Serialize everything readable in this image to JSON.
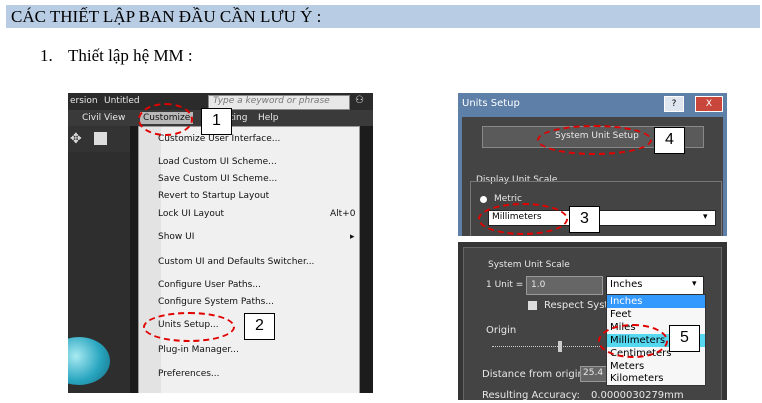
{
  "heading": "CÁC THIẾT LẬP BAN ĐẦU CẦN LƯU Ý :",
  "step": {
    "number": "1.",
    "text": "Thiết lập hệ MM :"
  },
  "max_window": {
    "title_left": "ersion",
    "title_doc": "Untitled",
    "search_placeholder": "Type a keyword or phrase",
    "menubar": [
      "Civil View",
      "Customize",
      "ting",
      "Help"
    ],
    "menu_items": [
      {
        "label": "Customize User Interface...",
        "shortcut": ""
      },
      {
        "label": "Load Custom UI Scheme...",
        "shortcut": ""
      },
      {
        "label": "Save Custom UI Scheme...",
        "shortcut": ""
      },
      {
        "label": "Revert to Startup Layout",
        "shortcut": ""
      },
      {
        "label": "Lock UI Layout",
        "shortcut": "Alt+0"
      },
      {
        "label": "Show UI",
        "shortcut": "▸"
      },
      {
        "label": "Custom UI and Defaults Switcher...",
        "shortcut": ""
      },
      {
        "label": "Configure User Paths...",
        "shortcut": ""
      },
      {
        "label": "Configure System Paths...",
        "shortcut": ""
      },
      {
        "label": "Units Setup...",
        "shortcut": ""
      },
      {
        "label": "Plug-in Manager...",
        "shortcut": ""
      },
      {
        "label": "Preferences...",
        "shortcut": ""
      }
    ]
  },
  "units_dialog": {
    "title": "Units Setup",
    "help_btn": "?",
    "close_btn": "X",
    "system_unit_button": "System Unit Setup",
    "display_group": "Display Unit Scale",
    "metric_label": "Metric",
    "metric_value": "Millimeters"
  },
  "system_dialog": {
    "group": "System Unit Scale",
    "unit_label": "1 Unit =",
    "unit_value": "1.0",
    "unit_select": "Inches",
    "respect_label": "Respect Syste",
    "origin_label": "Origin",
    "distance_label": "Distance from origin:",
    "distance_value": "25.4",
    "accuracy_label": "Resulting Accuracy:",
    "accuracy_value": "0.0000030279mm",
    "options": [
      "Inches",
      "Feet",
      "Miles",
      "Millimeters",
      "Centimeters",
      "Meters",
      "Kilometers"
    ],
    "selected": "Millimeters"
  },
  "callouts": [
    "1",
    "2",
    "3",
    "4",
    "5"
  ],
  "colors": {
    "heading_bg": "#b8cce4",
    "highlight": "#e00000",
    "menu_bg": "#f0f0f0",
    "dialog_bg": "#444444"
  }
}
